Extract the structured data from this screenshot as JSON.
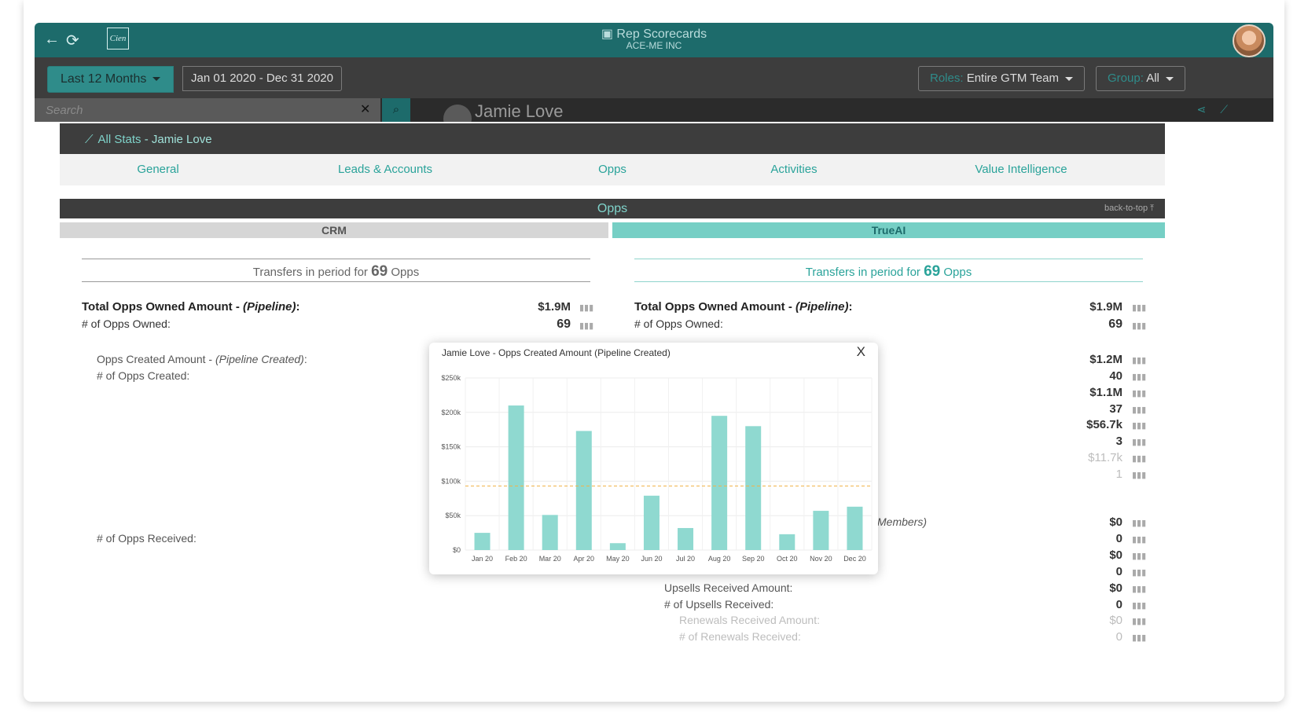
{
  "app": {
    "title": "Rep Scorecards",
    "company": "ACE-ME INC",
    "logo_text": "Cien"
  },
  "filters": {
    "period": "Last 12 Months",
    "date_range": "Jan 01 2020 - Dec 31 2020",
    "roles_label": "Roles:",
    "roles_value": "Entire GTM Team",
    "group_label": "Group:",
    "group_value": "All"
  },
  "search": {
    "placeholder": "Search"
  },
  "profile": {
    "name": "Jamie Love"
  },
  "stats_header": {
    "title": "All Stats",
    "person": "- Jamie Love"
  },
  "tabs": [
    "General",
    "Leads & Accounts",
    "Opps",
    "Activities",
    "Value Intelligence"
  ],
  "section": {
    "title": "Opps",
    "back_to_top": "back-to-top ⤒"
  },
  "subtabs": {
    "crm": "CRM",
    "trueai": "TrueAI"
  },
  "transfers": {
    "prefix": "Transfers in period for",
    "count": "69",
    "suffix": "Opps"
  },
  "left_rows": {
    "total_owned_label": "Total Opps Owned Amount -",
    "total_owned_em": "(Pipeline)",
    "total_owned_value": "$1.9M",
    "num_owned_label": "# of Opps Owned:",
    "num_owned_value": "69",
    "created_amount_label": "Opps Created Amount -",
    "created_amount_em": "(Pipeline Created)",
    "num_created_label": "# of Opps Created:",
    "num_received_label": "# of Opps Received:"
  },
  "right_rows": {
    "total_owned_label": "Total Opps Owned Amount -",
    "total_owned_em": "(Pipeline)",
    "total_owned_value": "$1.9M",
    "num_owned_label": "# of Opps Owned:",
    "num_owned_value": "69",
    "members_fragment": "Members)",
    "values": [
      "$1.2M",
      "40",
      "$1.1M",
      "37",
      "$56.7k",
      "3",
      "$11.7k",
      "1",
      "$0",
      "0",
      "$0",
      "0",
      "$0",
      "0",
      "$0",
      "0"
    ],
    "upsells_amount_label": "Upsells Received Amount:",
    "upsells_count_label": "# of Upsells Received:",
    "renewals_amount_label": "Renewals Received Amount:",
    "renewals_count_label": "# of Renewals Received:"
  },
  "popup": {
    "title": "Jamie Love - Opps Created Amount  (Pipeline Created)",
    "close": "X"
  },
  "chart_data": {
    "type": "bar",
    "title": "Jamie Love - Opps Created Amount  (Pipeline Created)",
    "categories": [
      "Jan 20",
      "Feb 20",
      "Mar 20",
      "Apr 20",
      "May 20",
      "Jun 20",
      "Jul 20",
      "Aug 20",
      "Sep 20",
      "Oct 20",
      "Nov 20",
      "Dec 20"
    ],
    "values": [
      25000,
      210000,
      51000,
      173000,
      10000,
      79000,
      32000,
      195000,
      180000,
      23000,
      57000,
      63000
    ],
    "ylim": [
      0,
      250000
    ],
    "yticks": [
      "$0",
      "$50k",
      "$100k",
      "$150k",
      "$200k",
      "$250k"
    ],
    "average_line": 93000,
    "grid": true,
    "colors": {
      "bar": "#8fd9d0",
      "average": "#f0b44a"
    }
  }
}
